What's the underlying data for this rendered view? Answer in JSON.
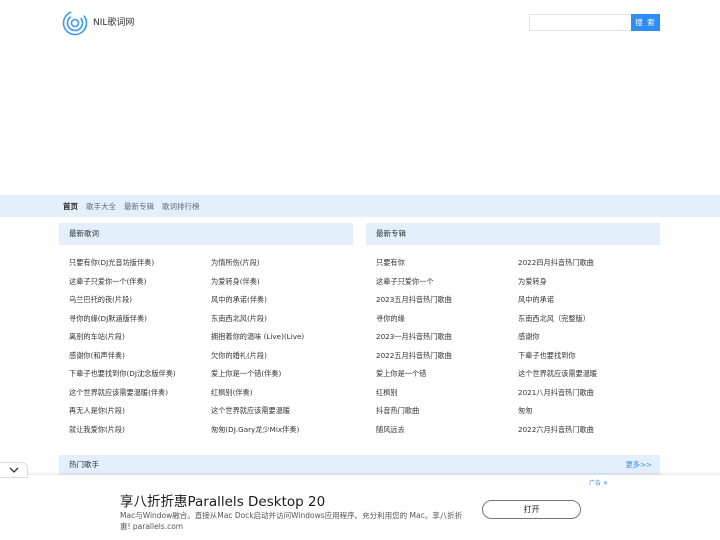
{
  "header": {
    "site_name": "NIL歌词网",
    "search_placeholder": "",
    "search_button": "搜 索"
  },
  "nav": {
    "items": [
      "首页",
      "歌手大全",
      "最新专辑",
      "歌词排行榜"
    ]
  },
  "latest_lyrics": {
    "title": "最新歌词",
    "rows": [
      [
        "只要有你(DJ光音坊版伴奏)",
        "为情所伤(片段)"
      ],
      [
        "这辈子只爱你一个(伴奏)",
        "为爱转身(伴奏)"
      ],
      [
        "乌兰巴托的夜(片段)",
        "风中的承诺(伴奏)"
      ],
      [
        "寻你的缘(DJ默涵版伴奏)",
        "东南西北风(片段)"
      ],
      [
        "离别的车站(片段)",
        "拥抱着你的温味 (Live)(Live)"
      ],
      [
        "感谢你(和声伴奏)",
        "欠你的婚礼(片段)"
      ],
      [
        "下辈子也要找到你(DJ沈念版伴奏)",
        "爱上你是一个错(伴奏)"
      ],
      [
        "这个世界就应该需要温暖(伴奏)",
        "红枫别(伴奏)"
      ],
      [
        "再无人是你(片段)",
        "这个世界就应该需要温暖"
      ],
      [
        "就让我爱你(片段)",
        "匆匆(DJ.Gary龙少Mix伴奏)"
      ]
    ]
  },
  "latest_albums": {
    "title": "最新专辑",
    "rows": [
      [
        "只要有你",
        "2022四月抖音热门歌曲"
      ],
      [
        "这辈子只爱你一个",
        "为爱转身"
      ],
      [
        "2023五月抖音热门歌曲",
        "风中的承诺"
      ],
      [
        "寻你的缘",
        "东南西北风（完整版）"
      ],
      [
        "2023一月抖音热门歌曲",
        "感谢你"
      ],
      [
        "2022五月抖音热门歌曲",
        "下辈子也要找到你"
      ],
      [
        "爱上你是一个错",
        "这个世界就应该需要温暖"
      ],
      [
        "红枫别",
        "2021八月抖音热门歌曲"
      ],
      [
        "抖音热门歌曲",
        "匆匆"
      ],
      [
        "随风远去",
        "2022六月抖音热门歌曲"
      ]
    ]
  },
  "hot_singers": {
    "title": "热门歌手",
    "more": "更多>>"
  },
  "ad": {
    "title": "享八折折惠Parallels Desktop 20",
    "description": "Mac与Window融合。直接从Mac Dock启动并访问Windows应用程序。充分利用您的 Mac。享八折折惠! parallels.com",
    "button": "打开",
    "label": "广告",
    "close": "✕"
  },
  "colors": {
    "accent": "#2f8df6",
    "section_bg": "#e3effa"
  }
}
